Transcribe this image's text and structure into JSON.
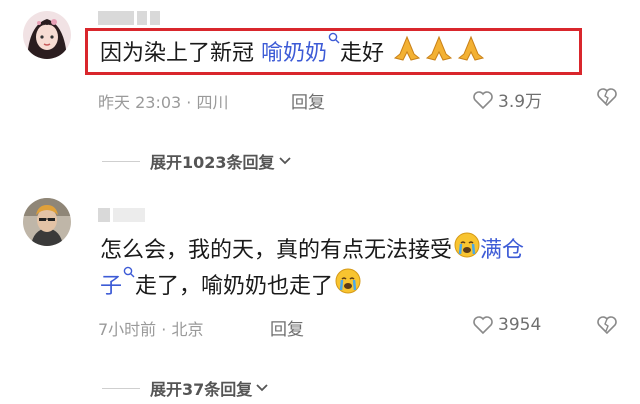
{
  "comments": [
    {
      "text_before": "因为染上了新冠",
      "link_text": "喻奶奶",
      "text_after": "走好",
      "meta": "昨天 23:03 · 四川",
      "reply_label": "回复",
      "likes": "3.9万",
      "expand_label": "展开1023条回复"
    },
    {
      "line1_text": "怎么会，我的天，真的有点无法接受",
      "line1_link": "满仓",
      "line2_link": "子",
      "line2_text": "走了，喻奶奶也走了",
      "meta": "7小时前 · 北京",
      "reply_label": "回复",
      "likes": "3954",
      "expand_label": "展开37条回复"
    }
  ],
  "colors": {
    "highlight_border": "#d9262c",
    "link": "#3d5bd6"
  },
  "icons": [
    "search-icon",
    "praying-hands-emoji",
    "crying-face-emoji",
    "heart-outline-icon",
    "broken-heart-icon",
    "chevron-down-icon"
  ]
}
